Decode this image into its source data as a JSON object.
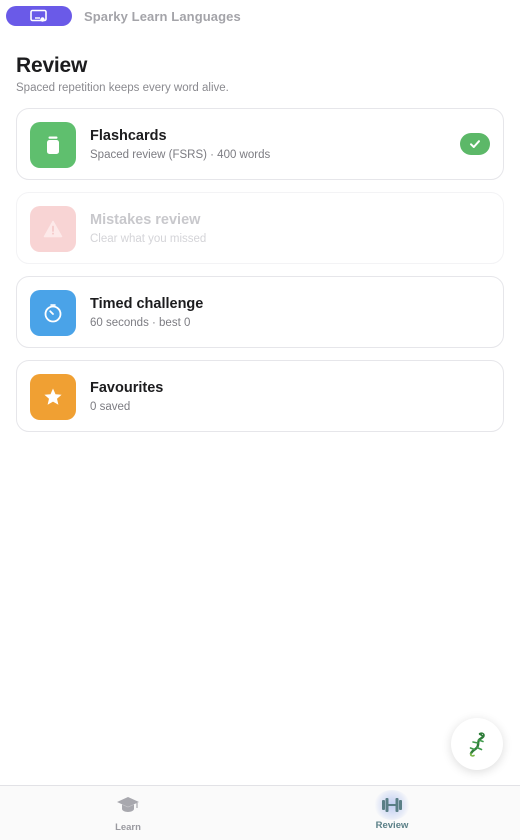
{
  "header": {
    "app_title": "Sparky Learn Languages",
    "pill_icon": "profile-card-icon",
    "pill_color": "#6a5ae8"
  },
  "page": {
    "title": "Review",
    "subtitle": "Spaced repetition keeps every word alive."
  },
  "cards": [
    {
      "title": "Flashcards",
      "subtitle": "Spaced review (FSRS) · 400 words",
      "icon": "card-stack-icon",
      "color": "#5fbf6e",
      "completed": true,
      "enabled": true
    },
    {
      "title": "Mistakes review",
      "subtitle": "Clear what you missed",
      "icon": "warning-icon",
      "color": "#f8d4d4",
      "completed": false,
      "enabled": false
    },
    {
      "title": "Timed challenge",
      "subtitle": "60 seconds · best 0",
      "icon": "timer-icon",
      "color": "#4aa3e8",
      "completed": false,
      "enabled": true
    },
    {
      "title": "Favourites",
      "subtitle": "0 saved",
      "icon": "star-icon",
      "color": "#f0a033",
      "completed": false,
      "enabled": true
    }
  ],
  "fab": {
    "icon": "gecko-mascot-icon"
  },
  "tabs": [
    {
      "label": "Learn",
      "icon": "graduation-cap-icon",
      "active": false
    },
    {
      "label": "Review",
      "icon": "dumbbell-icon",
      "active": true
    }
  ]
}
